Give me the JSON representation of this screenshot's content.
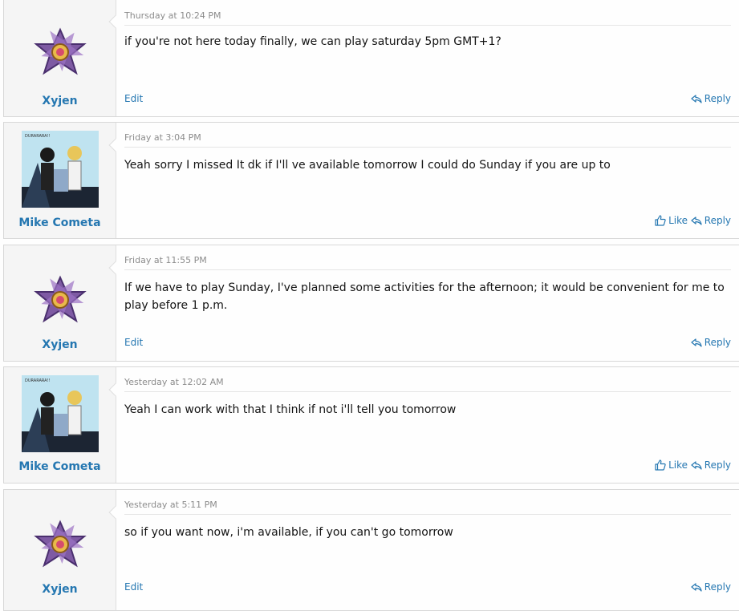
{
  "colors": {
    "link": "#2577b1",
    "page": "#fefefe",
    "user_panel": "#f5f5f5"
  },
  "posts": [
    {
      "author": "Xyjen",
      "avatar": "starmie",
      "date": "Thursday at 10:24 PM",
      "body": "if you're not here today finally, we can play saturday 5pm GMT+1?",
      "edit_label": "Edit",
      "reply_label": "Reply"
    },
    {
      "author": "Mike Cometa",
      "avatar": "anime-duo",
      "date": "Friday at 3:04 PM",
      "body": "Yeah sorry I missed It dk if I'll ve available tomorrow I could do Sunday if you are up to",
      "like_label": "Like",
      "reply_label": "Reply"
    },
    {
      "author": "Xyjen",
      "avatar": "starmie",
      "date": "Friday at 11:55 PM",
      "body": "If we have to play Sunday, I've planned some activities for the afternoon; it would be convenient for me to play before 1 p.m.",
      "edit_label": "Edit",
      "reply_label": "Reply"
    },
    {
      "author": "Mike Cometa",
      "avatar": "anime-duo",
      "date": "Yesterday at 12:02 AM",
      "body": "Yeah I can work with that I think if not i'll tell you tomorrow",
      "like_label": "Like",
      "reply_label": "Reply"
    },
    {
      "author": "Xyjen",
      "avatar": "starmie",
      "date": "Yesterday at 5:11 PM",
      "body": "so if you want now, i'm available, if you can't go tomorrow",
      "edit_label": "Edit",
      "reply_label": "Reply"
    }
  ]
}
